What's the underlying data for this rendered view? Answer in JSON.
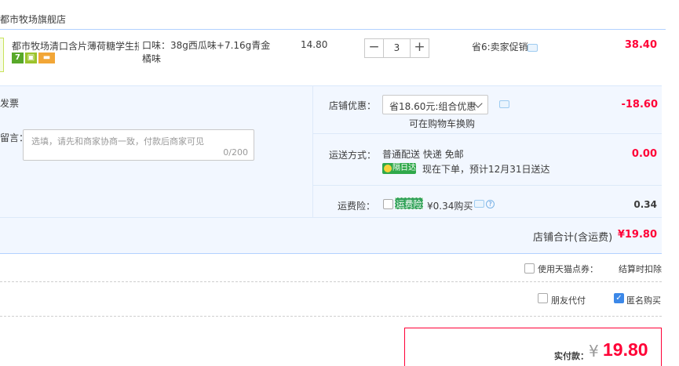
{
  "store": {
    "name": "都市牧场旗舰店"
  },
  "item": {
    "title": "都市牧场清口含片薄荷糖学生接...",
    "sku": "口味：38g西瓜味+7.16g青金橘味",
    "price": "14.80",
    "quantity": "3",
    "promo": "省6:卖家促销",
    "total": "38.40",
    "badges": [
      "7",
      "shield",
      "card"
    ]
  },
  "panel": {
    "invoice_label": "发票",
    "message_label": "留言：",
    "message_placeholder": "选填，请先和商家协商一致，付款后商家可见",
    "message_count": "0/200",
    "shop_discount_label": "店铺优惠：",
    "shop_discount_selected": "省18.60元:组合优惠",
    "shop_discount_swap": "可在购物车换购",
    "shop_discount_value": "-18.60",
    "shipping_label": "运送方式：",
    "shipping_method": "普通配送 快递 免邮",
    "shipping_badge": "隔日达",
    "shipping_note": "现在下单，预计12月31日送达",
    "shipping_value": "0.00",
    "insurance_label": "运费险：",
    "insurance_badge": "运费险",
    "insurance_price": "¥0.34购买",
    "insurance_value": "0.34",
    "subtotal_label": "店铺合计(含运费)",
    "subtotal_value": "¥19.80"
  },
  "options": {
    "tmall_points_label": "使用天猫点券：",
    "settle_label": "结算时扣除",
    "friend_pay_label": "朋友代付",
    "anonymous_label": "匿名购买"
  },
  "payment": {
    "label": "实付款：",
    "currency": "¥",
    "amount": "19.80"
  },
  "colors": {
    "accent": "#ff0036",
    "panel_bg": "#f2f7ff",
    "badge_green": "#32a35a"
  }
}
